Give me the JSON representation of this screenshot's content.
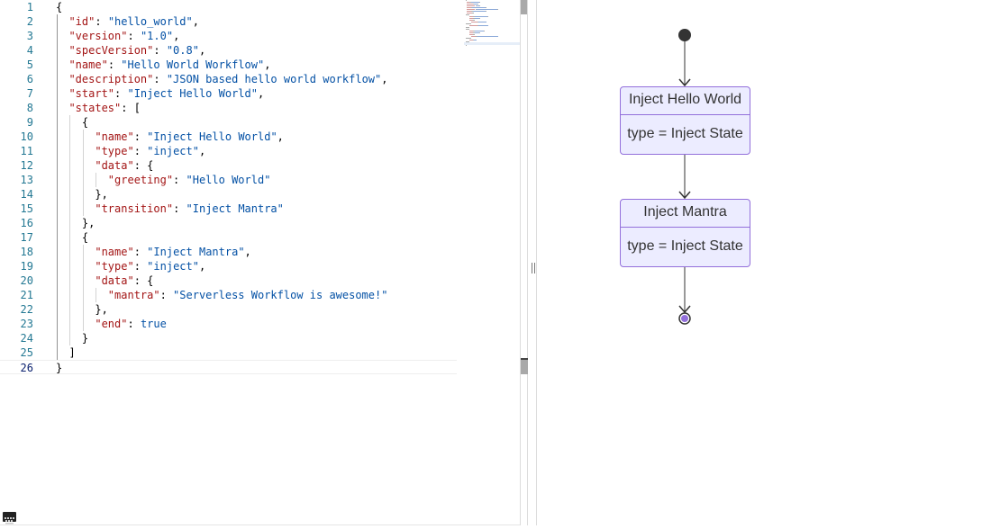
{
  "editor": {
    "language": "json",
    "current_line": 26,
    "lines": [
      {
        "n": "1",
        "tokens": [
          {
            "t": "p",
            "v": "{"
          }
        ]
      },
      {
        "n": "2",
        "tokens": [
          {
            "t": "p",
            "v": "  "
          },
          {
            "t": "k",
            "v": "\"id\""
          },
          {
            "t": "p",
            "v": ": "
          },
          {
            "t": "s",
            "v": "\"hello_world\""
          },
          {
            "t": "p",
            "v": ","
          }
        ]
      },
      {
        "n": "3",
        "tokens": [
          {
            "t": "p",
            "v": "  "
          },
          {
            "t": "k",
            "v": "\"version\""
          },
          {
            "t": "p",
            "v": ": "
          },
          {
            "t": "s",
            "v": "\"1.0\""
          },
          {
            "t": "p",
            "v": ","
          }
        ]
      },
      {
        "n": "4",
        "tokens": [
          {
            "t": "p",
            "v": "  "
          },
          {
            "t": "k",
            "v": "\"specVersion\""
          },
          {
            "t": "p",
            "v": ": "
          },
          {
            "t": "s",
            "v": "\"0.8\""
          },
          {
            "t": "p",
            "v": ","
          }
        ]
      },
      {
        "n": "5",
        "tokens": [
          {
            "t": "p",
            "v": "  "
          },
          {
            "t": "k",
            "v": "\"name\""
          },
          {
            "t": "p",
            "v": ": "
          },
          {
            "t": "s",
            "v": "\"Hello World Workflow\""
          },
          {
            "t": "p",
            "v": ","
          }
        ]
      },
      {
        "n": "6",
        "tokens": [
          {
            "t": "p",
            "v": "  "
          },
          {
            "t": "k",
            "v": "\"description\""
          },
          {
            "t": "p",
            "v": ": "
          },
          {
            "t": "s",
            "v": "\"JSON based hello world workflow\""
          },
          {
            "t": "p",
            "v": ","
          }
        ]
      },
      {
        "n": "7",
        "tokens": [
          {
            "t": "p",
            "v": "  "
          },
          {
            "t": "k",
            "v": "\"start\""
          },
          {
            "t": "p",
            "v": ": "
          },
          {
            "t": "s",
            "v": "\"Inject Hello World\""
          },
          {
            "t": "p",
            "v": ","
          }
        ]
      },
      {
        "n": "8",
        "tokens": [
          {
            "t": "p",
            "v": "  "
          },
          {
            "t": "k",
            "v": "\"states\""
          },
          {
            "t": "p",
            "v": ": ["
          }
        ]
      },
      {
        "n": "9",
        "tokens": [
          {
            "t": "p",
            "v": "    {"
          }
        ]
      },
      {
        "n": "10",
        "tokens": [
          {
            "t": "p",
            "v": "      "
          },
          {
            "t": "k",
            "v": "\"name\""
          },
          {
            "t": "p",
            "v": ": "
          },
          {
            "t": "s",
            "v": "\"Inject Hello World\""
          },
          {
            "t": "p",
            "v": ","
          }
        ]
      },
      {
        "n": "11",
        "tokens": [
          {
            "t": "p",
            "v": "      "
          },
          {
            "t": "k",
            "v": "\"type\""
          },
          {
            "t": "p",
            "v": ": "
          },
          {
            "t": "s",
            "v": "\"inject\""
          },
          {
            "t": "p",
            "v": ","
          }
        ]
      },
      {
        "n": "12",
        "tokens": [
          {
            "t": "p",
            "v": "      "
          },
          {
            "t": "k",
            "v": "\"data\""
          },
          {
            "t": "p",
            "v": ": {"
          }
        ]
      },
      {
        "n": "13",
        "tokens": [
          {
            "t": "p",
            "v": "        "
          },
          {
            "t": "k",
            "v": "\"greeting\""
          },
          {
            "t": "p",
            "v": ": "
          },
          {
            "t": "s",
            "v": "\"Hello World\""
          }
        ]
      },
      {
        "n": "14",
        "tokens": [
          {
            "t": "p",
            "v": "      },"
          }
        ]
      },
      {
        "n": "15",
        "tokens": [
          {
            "t": "p",
            "v": "      "
          },
          {
            "t": "k",
            "v": "\"transition\""
          },
          {
            "t": "p",
            "v": ": "
          },
          {
            "t": "s",
            "v": "\"Inject Mantra\""
          }
        ]
      },
      {
        "n": "16",
        "tokens": [
          {
            "t": "p",
            "v": "    },"
          }
        ]
      },
      {
        "n": "17",
        "tokens": [
          {
            "t": "p",
            "v": "    {"
          }
        ]
      },
      {
        "n": "18",
        "tokens": [
          {
            "t": "p",
            "v": "      "
          },
          {
            "t": "k",
            "v": "\"name\""
          },
          {
            "t": "p",
            "v": ": "
          },
          {
            "t": "s",
            "v": "\"Inject Mantra\""
          },
          {
            "t": "p",
            "v": ","
          }
        ]
      },
      {
        "n": "19",
        "tokens": [
          {
            "t": "p",
            "v": "      "
          },
          {
            "t": "k",
            "v": "\"type\""
          },
          {
            "t": "p",
            "v": ": "
          },
          {
            "t": "s",
            "v": "\"inject\""
          },
          {
            "t": "p",
            "v": ","
          }
        ]
      },
      {
        "n": "20",
        "tokens": [
          {
            "t": "p",
            "v": "      "
          },
          {
            "t": "k",
            "v": "\"data\""
          },
          {
            "t": "p",
            "v": ": {"
          }
        ]
      },
      {
        "n": "21",
        "tokens": [
          {
            "t": "p",
            "v": "        "
          },
          {
            "t": "k",
            "v": "\"mantra\""
          },
          {
            "t": "p",
            "v": ": "
          },
          {
            "t": "s",
            "v": "\"Serverless Workflow is awesome!\""
          }
        ]
      },
      {
        "n": "22",
        "tokens": [
          {
            "t": "p",
            "v": "      },"
          }
        ]
      },
      {
        "n": "23",
        "tokens": [
          {
            "t": "p",
            "v": "      "
          },
          {
            "t": "k",
            "v": "\"end\""
          },
          {
            "t": "p",
            "v": ": "
          },
          {
            "t": "b",
            "v": "true"
          }
        ]
      },
      {
        "n": "24",
        "tokens": [
          {
            "t": "p",
            "v": "    }"
          }
        ]
      },
      {
        "n": "25",
        "tokens": [
          {
            "t": "p",
            "v": "  ]"
          }
        ]
      },
      {
        "n": "26",
        "tokens": [
          {
            "t": "p",
            "v": "}"
          }
        ]
      }
    ]
  },
  "status": {
    "keyboard_icon": "keyboard-icon"
  },
  "diagram": {
    "states": [
      {
        "title": "Inject Hello World",
        "description": "type = Inject State"
      },
      {
        "title": "Inject Mantra",
        "description": "type = Inject State"
      }
    ],
    "colors": {
      "state_fill": "#ececff",
      "state_border": "#9370db",
      "end_fill": "#9370db",
      "edge": "#333333"
    }
  }
}
